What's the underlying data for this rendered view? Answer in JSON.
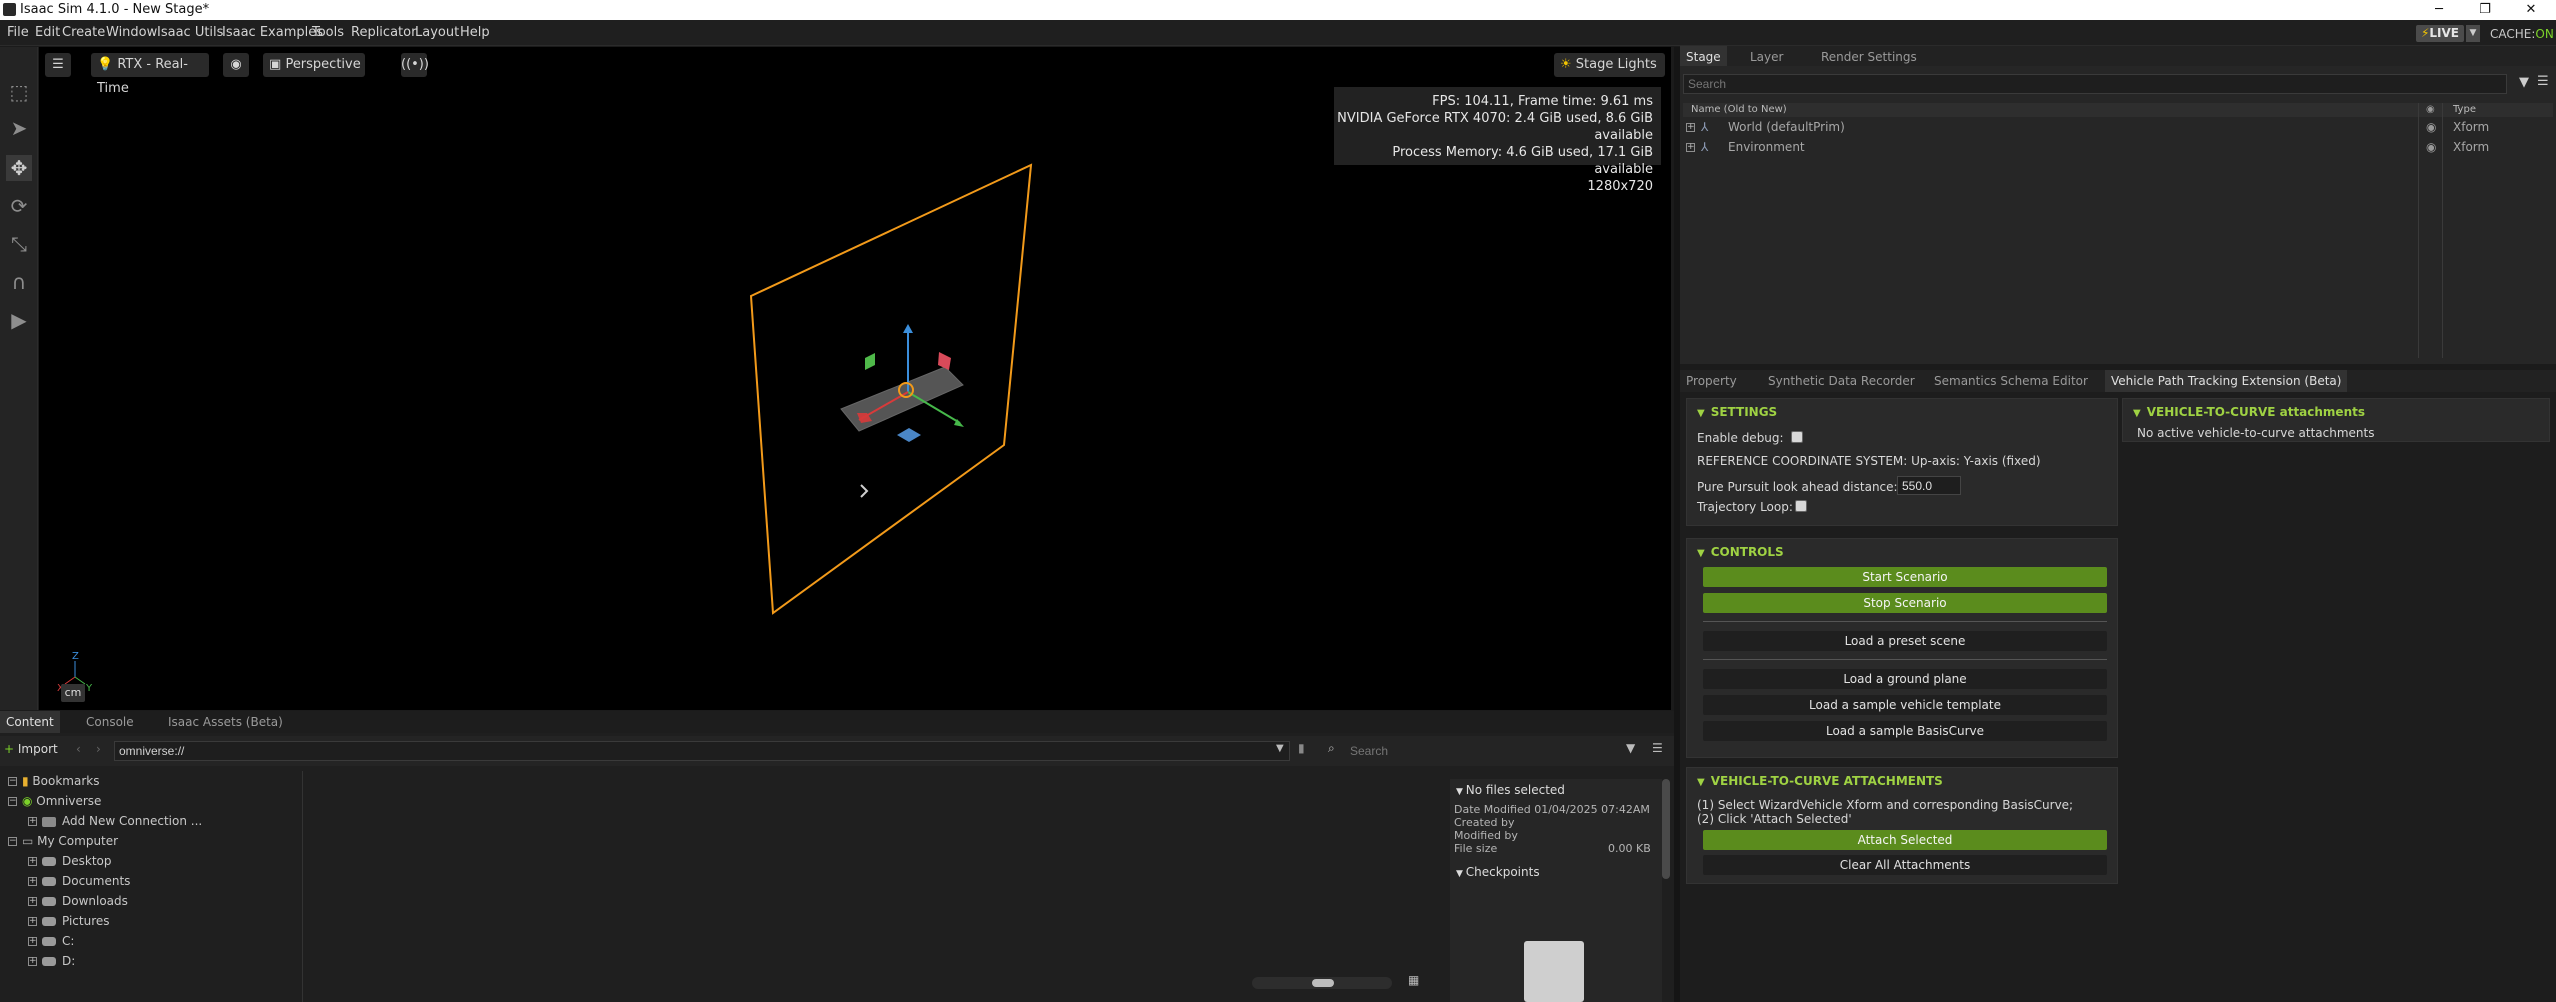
{
  "window": {
    "title": "Isaac Sim 4.1.0 - New Stage*",
    "minimize": "─",
    "maximize": "❐",
    "close": "✕"
  },
  "menu": [
    "File",
    "Edit",
    "Create",
    "Window",
    "Isaac Utils",
    "Isaac Examples",
    "Tools",
    "Replicator",
    "Layout",
    "Help"
  ],
  "status": {
    "live": "LIVE",
    "cache_label": "CACHE:",
    "cache_value": "ON"
  },
  "viewport": {
    "renderer": "RTX - Real-Time",
    "camera": "Perspective",
    "lights": "Stage Lights",
    "stats": [
      "FPS: 104.11, Frame time: 9.61 ms",
      "NVIDIA GeForce RTX 4070: 2.4 GiB used, 8.6 GiB available",
      "Process Memory: 4.6 GiB used, 17.1 GiB available",
      "1280x720"
    ],
    "units": "cm",
    "axes": {
      "z": "Z",
      "x": "X",
      "y": "Y"
    }
  },
  "stage": {
    "tabs": [
      "Stage",
      "Layer",
      "Render Settings"
    ],
    "search_placeholder": "Search",
    "col_name": "Name (Old to New)",
    "col_type": "Type",
    "rows": [
      {
        "name": "World (defaultPrim)",
        "type": "Xform"
      },
      {
        "name": "Environment",
        "type": "Xform"
      }
    ]
  },
  "props": {
    "tabs": [
      "Property",
      "Synthetic Data Recorder",
      "Semantics Schema Editor",
      "Vehicle Path Tracking Extension (Beta)"
    ],
    "settings": {
      "title": "SETTINGS",
      "enable_debug": "Enable debug:",
      "ref_coord": "REFERENCE COORDINATE SYSTEM: Up-axis: Y-axis (fixed)",
      "lookahead_label": "Pure Pursuit look ahead distance:",
      "lookahead_value": "550.0",
      "trajectory_loop": "Trajectory Loop:"
    },
    "controls": {
      "title": "CONTROLS",
      "start": "Start Scenario",
      "stop": "Stop Scenario",
      "preset": "Load a preset scene",
      "ground": "Load a ground plane",
      "vehicle": "Load a sample vehicle template",
      "curve": "Load a sample BasisCurve"
    },
    "attachments": {
      "title": "VEHICLE-TO-CURVE ATTACHMENTS",
      "step1": "(1) Select WizardVehicle Xform and corresponding BasisCurve;",
      "step2": "(2) Click 'Attach Selected'",
      "attach": "Attach Selected",
      "clear": "Clear All Attachments"
    },
    "attach_panel": {
      "title": "VEHICLE-TO-CURVE attachments",
      "empty": "No active vehicle-to-curve attachments"
    }
  },
  "content": {
    "tabs": [
      "Content",
      "Console",
      "Isaac Assets (Beta)"
    ],
    "import": "Import",
    "path": "omniverse://",
    "search_placeholder": "Search",
    "tree": [
      {
        "label": "Bookmarks",
        "icon": "bookmark-icon",
        "level": 0
      },
      {
        "label": "Omniverse",
        "icon": "omniverse-icon",
        "level": 0
      },
      {
        "label": "Add New Connection ...",
        "icon": "server-icon",
        "level": 1
      },
      {
        "label": "My Computer",
        "icon": "computer-icon",
        "level": 0
      },
      {
        "label": "Desktop",
        "icon": "drive-icon",
        "level": 1
      },
      {
        "label": "Documents",
        "icon": "drive-icon",
        "level": 1
      },
      {
        "label": "Downloads",
        "icon": "drive-icon",
        "level": 1
      },
      {
        "label": "Pictures",
        "icon": "drive-icon",
        "level": 1
      },
      {
        "label": "C:",
        "icon": "drive-icon",
        "level": 1
      },
      {
        "label": "D:",
        "icon": "drive-icon",
        "level": 1
      }
    ],
    "info": {
      "title": "No files selected",
      "date_modified": "Date Modified 01/04/2025 07:42AM",
      "created_by": "Created by",
      "modified_by": "Modified by",
      "file_size_label": "File size",
      "file_size_value": "0.00 KB",
      "checkpoints": "Checkpoints"
    }
  },
  "colors": {
    "accent_green": "#9fd243",
    "button_green": "#5b8c1d",
    "selection_orange": "#f29a1a"
  }
}
